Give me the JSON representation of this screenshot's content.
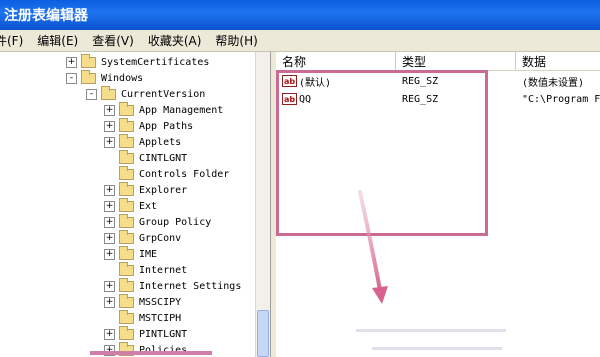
{
  "window": {
    "title": "注册表编辑器"
  },
  "menu": [
    {
      "label": "件(F)"
    },
    {
      "label": "编辑(E)"
    },
    {
      "label": "查看(V)"
    },
    {
      "label": "收藏夹(A)"
    },
    {
      "label": "帮助(H)"
    }
  ],
  "tree": [
    {
      "label": "SystemCertificates",
      "expander": "+"
    },
    {
      "label": "Windows",
      "expander": "-"
    },
    {
      "label": "CurrentVersion",
      "expander": "-"
    },
    {
      "label": "App Management",
      "expander": "+"
    },
    {
      "label": "App Paths",
      "expander": "+"
    },
    {
      "label": "Applets",
      "expander": "+"
    },
    {
      "label": "CINTLGNT",
      "expander": ""
    },
    {
      "label": "Controls Folder",
      "expander": ""
    },
    {
      "label": "Explorer",
      "expander": "+"
    },
    {
      "label": "Ext",
      "expander": "+"
    },
    {
      "label": "Group Policy",
      "expander": "+"
    },
    {
      "label": "GrpConv",
      "expander": "+"
    },
    {
      "label": "IME",
      "expander": "+"
    },
    {
      "label": "Internet",
      "expander": ""
    },
    {
      "label": "Internet Settings",
      "expander": "+"
    },
    {
      "label": "MSSCIPY",
      "expander": "+"
    },
    {
      "label": "MSTCIPH",
      "expander": ""
    },
    {
      "label": "PINTLGNT",
      "expander": "+"
    },
    {
      "label": "Policies",
      "expander": "+"
    }
  ],
  "list": {
    "columns": [
      {
        "label": "名称"
      },
      {
        "label": "类型"
      },
      {
        "label": "数据"
      }
    ],
    "rows": [
      {
        "name": "(默认)",
        "type": "REG_SZ",
        "data": "(数值未设置)",
        "icon": "string-value-icon"
      },
      {
        "name": "QQ",
        "type": "REG_SZ",
        "data": "\"C:\\Program F",
        "icon": "string-value-icon"
      }
    ]
  },
  "icon_text": "ab",
  "colors": {
    "title_bar": "#0a5fe0",
    "annotation": "#c96b93"
  }
}
